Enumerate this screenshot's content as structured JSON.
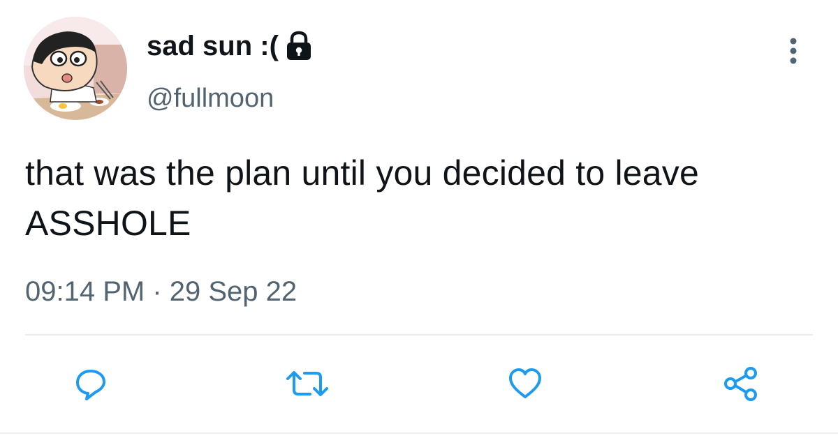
{
  "tweet": {
    "display_name": "sad sun :(",
    "handle": "@fullmoon",
    "text": "that was the plan until you decided to leave ASSHOLE",
    "time": "09:14 PM",
    "separator": " · ",
    "date": "29 Sep 22",
    "protected": true
  },
  "icons": {
    "lock": "lock-icon",
    "more": "more-vertical-icon",
    "reply": "reply-bubble-icon",
    "retweet": "retweet-icon",
    "like": "heart-icon",
    "share": "share-icon"
  },
  "colors": {
    "text": "#0f1419",
    "secondary": "#536471",
    "icon": "#1d9bf0"
  }
}
